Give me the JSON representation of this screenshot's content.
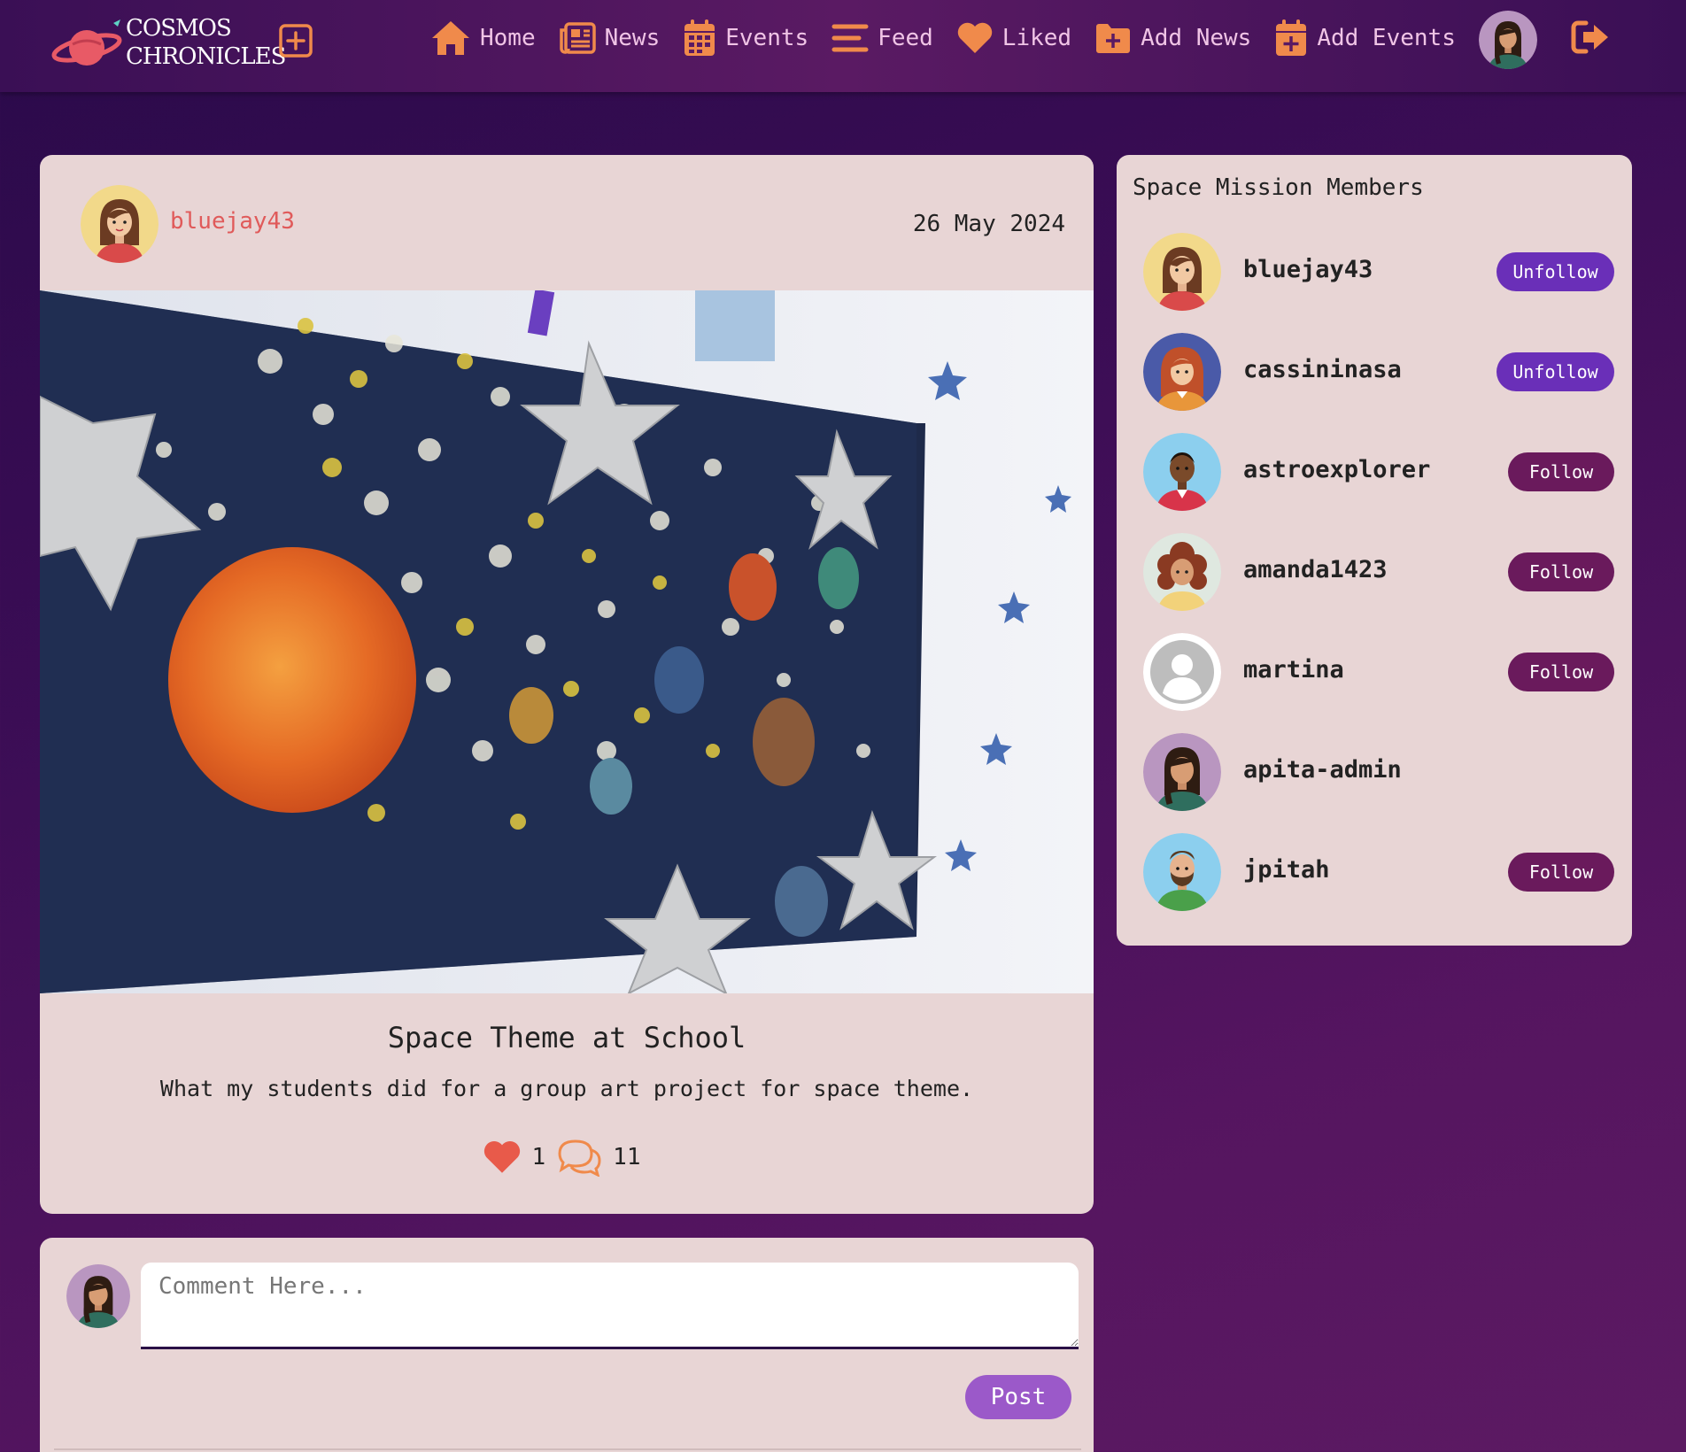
{
  "brand": {
    "line1": "COSMOS",
    "line2": "CHRONICLES"
  },
  "nav": {
    "items": [
      {
        "label": "Home",
        "icon": "home-icon"
      },
      {
        "label": "News",
        "icon": "newspaper-icon"
      },
      {
        "label": "Events",
        "icon": "calendar-icon"
      },
      {
        "label": "Feed",
        "icon": "feed-icon"
      },
      {
        "label": "Liked",
        "icon": "heart-icon"
      },
      {
        "label": "Add News",
        "icon": "folder-plus-icon"
      },
      {
        "label": "Add Events",
        "icon": "calendar-plus-icon"
      }
    ]
  },
  "post": {
    "username": "bluejay43",
    "date": "26 May 2024",
    "title": "Space Theme at School",
    "description": "What my students did for a group art project for space theme.",
    "likes": "1",
    "comments": "11"
  },
  "comment_form": {
    "placeholder": "Comment Here...",
    "post_label": "Post"
  },
  "members": {
    "title": "Space Mission Members",
    "list": [
      {
        "name": "bluejay43",
        "action": "Unfollow"
      },
      {
        "name": "cassininasa",
        "action": "Unfollow"
      },
      {
        "name": "astroexplorer",
        "action": "Follow"
      },
      {
        "name": "amanda1423",
        "action": "Follow"
      },
      {
        "name": "martina",
        "action": "Follow"
      },
      {
        "name": "apita-admin",
        "action": ""
      },
      {
        "name": "jpitah",
        "action": "Follow"
      }
    ]
  },
  "colors": {
    "accent_orange": "#f08a4b",
    "nav_text": "#f0c4e6",
    "card_bg": "#e8d5d5",
    "username_red": "#e05a5a",
    "unfollow_btn": "#6a2fb8",
    "follow_btn": "#6a1a5c",
    "post_btn": "#9b59c9"
  }
}
